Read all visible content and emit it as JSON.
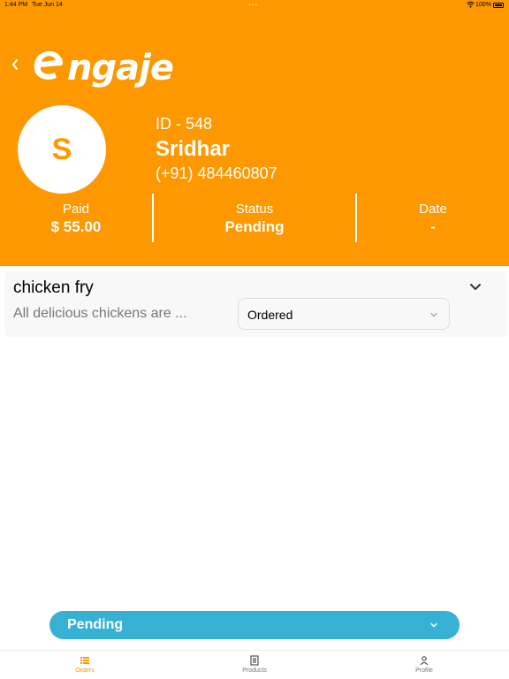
{
  "status_bar": {
    "time": "1:44 PM",
    "date": "Tue Jun 14",
    "dots": "•••",
    "battery": "100%"
  },
  "header": {
    "logo_text": "ngaje",
    "avatar_initial": "S",
    "customer_id": "ID - 548",
    "customer_name": "Sridhar",
    "customer_phone": "(+91) 484460807",
    "stats": {
      "paid": {
        "label": "Paid",
        "value": "$ 55.00"
      },
      "status": {
        "label": "Status",
        "value": "Pending"
      },
      "date": {
        "label": "Date",
        "value": "-"
      }
    }
  },
  "order": {
    "title": "chicken fry",
    "description": "All delicious chickens are ...",
    "item_status": "Ordered"
  },
  "status_selector": {
    "value": "Pending"
  },
  "bottom_nav": {
    "orders": {
      "label": "Orders",
      "icon": "list-icon"
    },
    "products": {
      "label": "Products",
      "icon": "document-icon"
    },
    "profile": {
      "label": "Profile",
      "icon": "person-icon"
    }
  },
  "colors": {
    "brand": "#fd9800",
    "accent_blue": "#36b1d4",
    "muted": "#777777"
  }
}
